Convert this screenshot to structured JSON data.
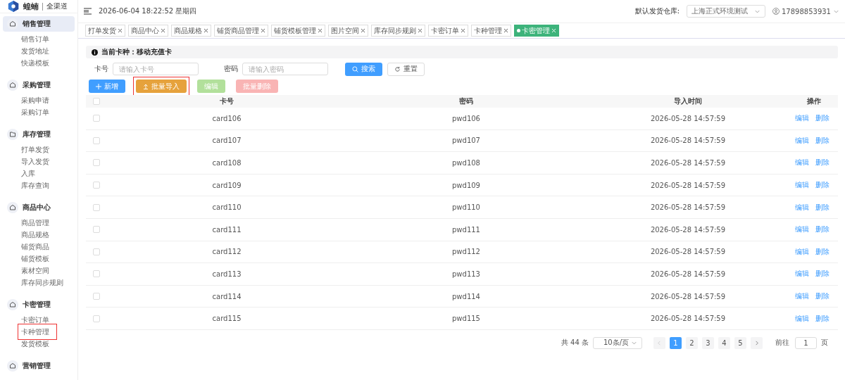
{
  "brand": {
    "name": "蝗蝻",
    "subtitle": "全渠道"
  },
  "header": {
    "datetime": "2026-06-04 18:22:52 星期四",
    "warehouse_label": "默认发货仓库:",
    "warehouse_value": "上海正式环境测试",
    "user": "17898853931"
  },
  "sidebar": {
    "groups": [
      {
        "label": "销售管理",
        "selected": true,
        "items": [
          {
            "label": "销售订单",
            "highlighted": false
          },
          {
            "label": "发货地址",
            "highlighted": false
          },
          {
            "label": "快递模板",
            "highlighted": false
          }
        ]
      },
      {
        "label": "采购管理",
        "selected": false,
        "items": [
          {
            "label": "采购申请",
            "highlighted": false
          },
          {
            "label": "采购订单",
            "highlighted": false
          }
        ]
      },
      {
        "label": "库存管理",
        "selected": false,
        "items": [
          {
            "label": "打单发货",
            "highlighted": false
          },
          {
            "label": "导入发货",
            "highlighted": false
          },
          {
            "label": "入库",
            "highlighted": false
          },
          {
            "label": "库存查询",
            "highlighted": false
          }
        ]
      },
      {
        "label": "商品中心",
        "selected": false,
        "items": [
          {
            "label": "商品管理",
            "highlighted": false
          },
          {
            "label": "商品规格",
            "highlighted": false
          },
          {
            "label": "铺货商品",
            "highlighted": false
          },
          {
            "label": "铺货模板",
            "highlighted": false
          },
          {
            "label": "素材空间",
            "highlighted": false
          },
          {
            "label": "库存同步规则",
            "highlighted": false
          }
        ]
      },
      {
        "label": "卡密管理",
        "selected": false,
        "items": [
          {
            "label": "卡密订单",
            "highlighted": false
          },
          {
            "label": "卡种管理",
            "highlighted": true
          },
          {
            "label": "发货模板",
            "highlighted": false
          }
        ]
      },
      {
        "label": "营销管理",
        "selected": false
      }
    ]
  },
  "tabs": [
    {
      "label": "打单发货",
      "selected": false
    },
    {
      "label": "商品中心",
      "selected": false
    },
    {
      "label": "商品规格",
      "selected": false
    },
    {
      "label": "铺货商品管理",
      "selected": false
    },
    {
      "label": "铺货模板管理",
      "selected": false
    },
    {
      "label": "图片空间",
      "selected": false
    },
    {
      "label": "库存同步规则",
      "selected": false
    },
    {
      "label": "卡密订单",
      "selected": false
    },
    {
      "label": "卡种管理",
      "selected": false
    },
    {
      "label": "卡密管理",
      "selected": true
    }
  ],
  "notice": "当前卡种：移动充值卡",
  "filters": [
    {
      "label": "卡号",
      "placeholder": "请输入卡号"
    },
    {
      "label": "密码",
      "placeholder": "请输入密码"
    }
  ],
  "search_button": "搜索",
  "reset_button": "重置",
  "actions": [
    {
      "label": "新增",
      "kind": "add",
      "disabled": false,
      "highlighted": false
    },
    {
      "label": "批量导入",
      "kind": "import",
      "disabled": false,
      "highlighted": true
    },
    {
      "label": "编辑",
      "kind": "edit",
      "disabled": true,
      "highlighted": false
    },
    {
      "label": "批量删除",
      "kind": "delete",
      "disabled": true,
      "highlighted": false
    }
  ],
  "table": {
    "all_checked": false,
    "columns": [
      "卡号",
      "密码",
      "导入时间",
      "操作"
    ],
    "rows": [
      {
        "card": "card106",
        "password": "pwd106",
        "time": "2026-05-28 14:57:59",
        "checked": false,
        "edit": "编辑",
        "delete": "删除"
      },
      {
        "card": "card107",
        "password": "pwd107",
        "time": "2026-05-28 14:57:59",
        "checked": false,
        "edit": "编辑",
        "delete": "删除"
      },
      {
        "card": "card108",
        "password": "pwd108",
        "time": "2026-05-28 14:57:59",
        "checked": false,
        "edit": "编辑",
        "delete": "删除"
      },
      {
        "card": "card109",
        "password": "pwd109",
        "time": "2026-05-28 14:57:59",
        "checked": false,
        "edit": "编辑",
        "delete": "删除"
      },
      {
        "card": "card110",
        "password": "pwd110",
        "time": "2026-05-28 14:57:59",
        "checked": false,
        "edit": "编辑",
        "delete": "删除"
      },
      {
        "card": "card111",
        "password": "pwd111",
        "time": "2026-05-28 14:57:59",
        "checked": false,
        "edit": "编辑",
        "delete": "删除"
      },
      {
        "card": "card112",
        "password": "pwd112",
        "time": "2026-05-28 14:57:59",
        "checked": false,
        "edit": "编辑",
        "delete": "删除"
      },
      {
        "card": "card113",
        "password": "pwd113",
        "time": "2026-05-28 14:57:59",
        "checked": false,
        "edit": "编辑",
        "delete": "删除"
      },
      {
        "card": "card114",
        "password": "pwd114",
        "time": "2026-05-28 14:57:59",
        "checked": false,
        "edit": "编辑",
        "delete": "删除"
      },
      {
        "card": "card115",
        "password": "pwd115",
        "time": "2026-05-28 14:57:59",
        "checked": false,
        "edit": "编辑",
        "delete": "删除"
      }
    ]
  },
  "pagination": {
    "total": "共 44 条",
    "page_size": "10条/页",
    "pages": [
      {
        "label": "1",
        "selected": true
      },
      {
        "label": "2",
        "selected": false
      },
      {
        "label": "3",
        "selected": false
      },
      {
        "label": "4",
        "selected": false
      },
      {
        "label": "5",
        "selected": false
      }
    ],
    "goto_label": "前往",
    "goto_value": "1",
    "page_unit": "页"
  }
}
